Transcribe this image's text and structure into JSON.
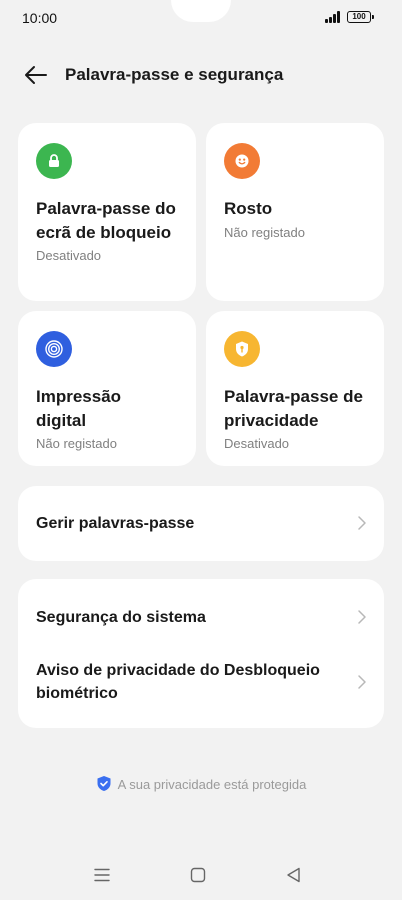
{
  "status_bar": {
    "time": "10:00",
    "battery": "100"
  },
  "header": {
    "title": "Palavra-passe e segurança"
  },
  "tiles": [
    {
      "title": "Palavra-passe do ecrã de bloqueio",
      "status": "Desativado",
      "icon": "lock-icon",
      "color": "#3cb650"
    },
    {
      "title": "Rosto",
      "status": "Não registado",
      "icon": "face-icon",
      "color": "#f27b35"
    },
    {
      "title": "Impressão digital",
      "status": "Não registado",
      "icon": "fingerprint-icon",
      "color": "#2f5fdf"
    },
    {
      "title": "Palavra-passe de privacidade",
      "status": "Desativado",
      "icon": "privacy-key-icon",
      "color": "#f7b631"
    }
  ],
  "password_manager": {
    "label": "Gerir palavras-passe"
  },
  "security_list": [
    {
      "label": "Segurança do sistema"
    },
    {
      "label": "Aviso de privacidade do Desbloqueio biométrico"
    }
  ],
  "footer": {
    "privacy_text": "A sua privacidade está protegida"
  }
}
